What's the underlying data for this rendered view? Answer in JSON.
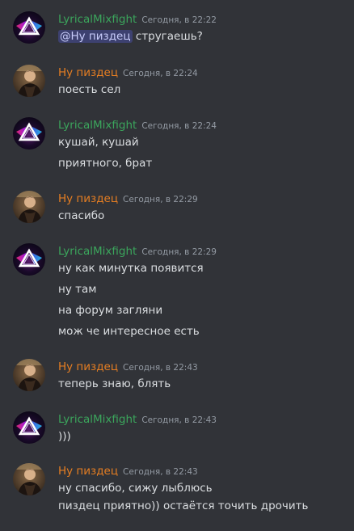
{
  "users": {
    "lyrical": {
      "name": "LyricalMixfight",
      "color": "#3ba55c",
      "avatar_icon": "neon-triangle-avatar"
    },
    "nu": {
      "name": "Ну пиздец",
      "color": "#e67e22",
      "avatar_icon": "person-photo-avatar"
    }
  },
  "messages": [
    {
      "author": "LyricalMixfight",
      "timestamp": "Сегодня, в 22:22",
      "mention": "@Ну пиздец",
      "text": " стругаешь?"
    },
    {
      "author": "Ну пиздец",
      "timestamp": "Сегодня, в 22:24",
      "lines": [
        "поесть сел"
      ]
    },
    {
      "author": "LyricalMixfight",
      "timestamp": "Сегодня, в 22:24",
      "lines": [
        "кушай, кушай",
        "приятного, брат"
      ]
    },
    {
      "author": "Ну пиздец",
      "timestamp": "Сегодня, в 22:29",
      "lines": [
        "спасибо"
      ]
    },
    {
      "author": "LyricalMixfight",
      "timestamp": "Сегодня, в 22:29",
      "lines": [
        "ну как минутка появится",
        "ну там",
        "на форум загляни",
        "мож че интересное есть"
      ]
    },
    {
      "author": "Ну пиздец",
      "timestamp": "Сегодня, в 22:43",
      "lines": [
        "теперь знаю, блять"
      ]
    },
    {
      "author": "LyricalMixfight",
      "timestamp": "Сегодня, в 22:43",
      "lines": [
        ")))"
      ]
    },
    {
      "author": "Ну пиздец",
      "timestamp": "Сегодня, в 22:43",
      "lines": [
        "ну спасибо, сижу лыблюсь",
        "пиздец приятно)) остаётся точить дрочить"
      ]
    }
  ]
}
